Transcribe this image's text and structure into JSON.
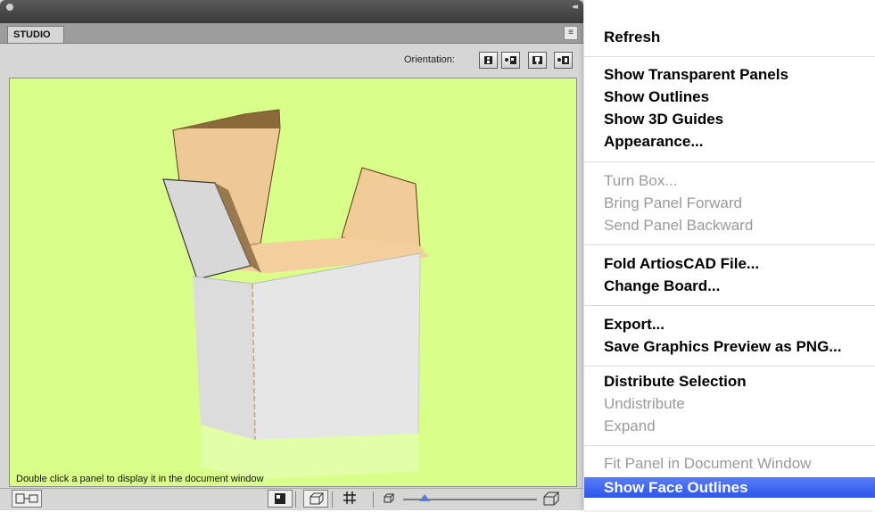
{
  "panel": {
    "tab_label": "STUDIO",
    "orientation_label": "Orientation:",
    "status_text": "Double click a panel to display it in the document window",
    "orientation_buttons": [
      "front-view-icon",
      "side-view-icon",
      "top-view-icon",
      "back-view-icon"
    ],
    "bottom_buttons": [
      "panel-flatten-icon",
      "face-shade-icon",
      "box-wireframe-icon",
      "grid-icon",
      "box-small-icon",
      "box-large-icon"
    ],
    "viewport_bg": "#d9ff8a",
    "zoom_level": 0.12
  },
  "menu": {
    "groups": [
      [
        {
          "label": "Refresh",
          "enabled": true
        }
      ],
      [
        {
          "label": "Show Transparent Panels",
          "enabled": true
        },
        {
          "label": "Show Outlines",
          "enabled": true
        },
        {
          "label": "Show 3D Guides",
          "enabled": true
        },
        {
          "label": "Appearance...",
          "enabled": true
        }
      ],
      [
        {
          "label": "Turn Box...",
          "enabled": false
        },
        {
          "label": "Bring Panel Forward",
          "enabled": false
        },
        {
          "label": "Send Panel Backward",
          "enabled": false
        }
      ],
      [
        {
          "label": "Fold ArtiosCAD File...",
          "enabled": true
        },
        {
          "label": "Change Board...",
          "enabled": true
        }
      ],
      [
        {
          "label": "Export...",
          "enabled": true
        },
        {
          "label": "Save Graphics Preview as PNG...",
          "enabled": true
        }
      ],
      [
        {
          "label": "Distribute Selection",
          "enabled": true
        },
        {
          "label": "Undistribute",
          "enabled": false
        },
        {
          "label": "Expand",
          "enabled": false
        }
      ],
      [
        {
          "label": "Fit Panel in Document Window",
          "enabled": false
        },
        {
          "label": "Show Face Outlines",
          "enabled": true,
          "highlighted": true
        }
      ]
    ],
    "highlight_color": "#3b62f2"
  }
}
